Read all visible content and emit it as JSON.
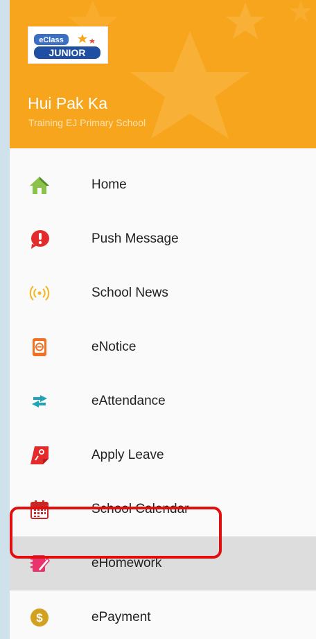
{
  "header": {
    "logo_alt": "eClass JUNIOR",
    "user_name": "Hui Pak Ka",
    "school_name": "Training EJ Primary School"
  },
  "menu": {
    "items": [
      {
        "label": "Home",
        "icon": "home-icon"
      },
      {
        "label": "Push Message",
        "icon": "push-message-icon"
      },
      {
        "label": "School News",
        "icon": "school-news-icon"
      },
      {
        "label": "eNotice",
        "icon": "enotice-icon"
      },
      {
        "label": "eAttendance",
        "icon": "eattendance-icon"
      },
      {
        "label": "Apply Leave",
        "icon": "apply-leave-icon"
      },
      {
        "label": "School Calendar",
        "icon": "school-calendar-icon"
      },
      {
        "label": "eHomework",
        "icon": "ehomework-icon"
      },
      {
        "label": "ePayment",
        "icon": "epayment-icon"
      }
    ],
    "selected": "eHomework"
  },
  "colors": {
    "header_bg": "#f7a51d",
    "selected_bg": "#dddddd",
    "highlight_border": "#e01010"
  }
}
